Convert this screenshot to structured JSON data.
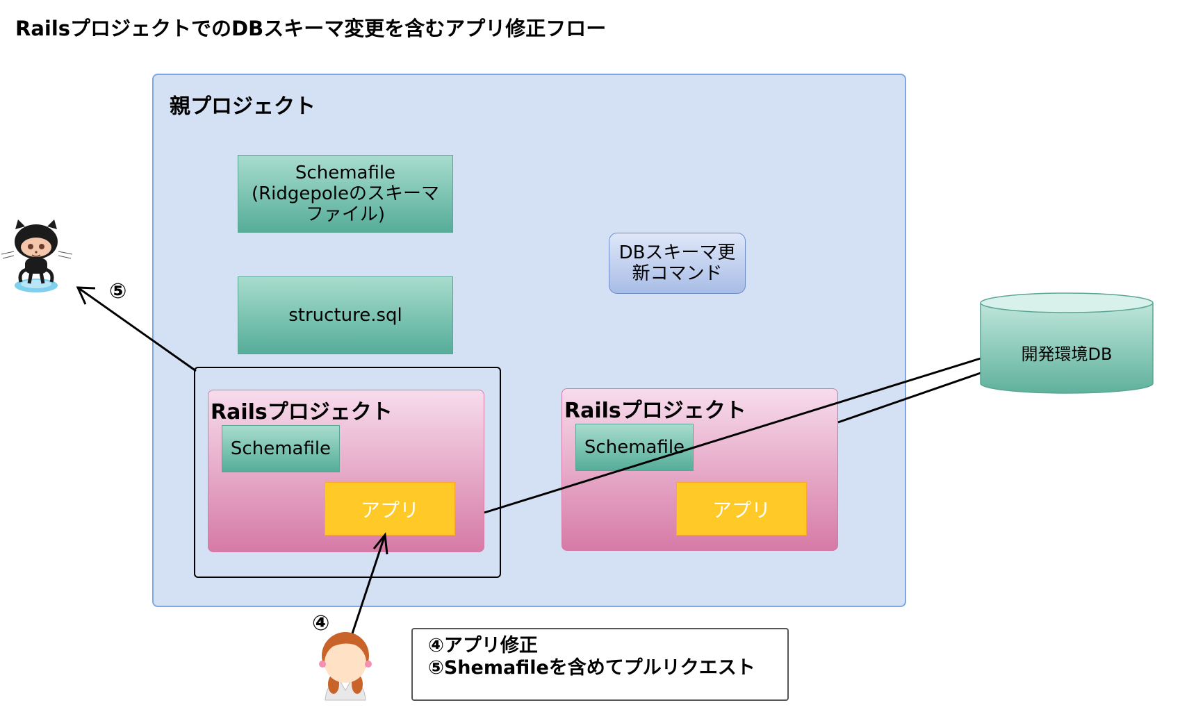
{
  "title": "RailsプロジェクトでのDBスキーマ変更を含むアプリ修正フロー",
  "parent_project": {
    "label": "親プロジェクト",
    "schemafile_box": "Schemafile\n(Ridgepoleのスキーマ\nファイル)",
    "structure_box": "structure.sql",
    "command_box": "DBスキーマ更\n新コマンド"
  },
  "rails_project_left": {
    "label": "Railsプロジェクト",
    "schemafile": "Schemafile",
    "app": "アプリ"
  },
  "rails_project_right": {
    "label": "Railsプロジェクト",
    "schemafile": "Schemafile",
    "app": "アプリ"
  },
  "database": {
    "label": "開発環境DB"
  },
  "markers": {
    "step4": "④",
    "step5": "⑤"
  },
  "note": {
    "line1": "④アプリ修正",
    "line2": "⑤Shemafileを含めてプルリクエスト"
  },
  "icons": {
    "github": "github-octocat-icon",
    "developer": "developer-person-icon",
    "database": "database-cylinder-icon"
  },
  "colors": {
    "parent_fill": "#d4e1f4",
    "parent_border": "#7ea6e0",
    "teal_fill": "#67b8a3",
    "rails_fill": "#e8a9c9",
    "app_fill": "#ffca28",
    "command_fill": "#b8c9ec"
  }
}
